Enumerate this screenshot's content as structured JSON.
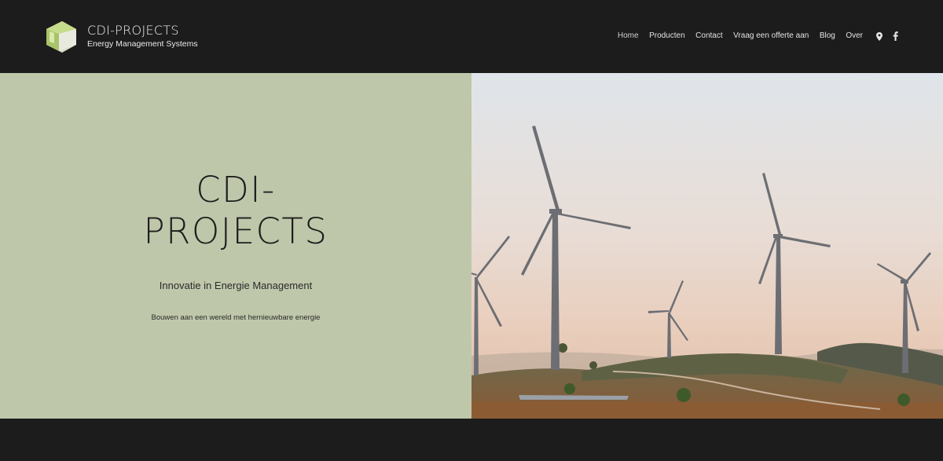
{
  "header": {
    "brand_name": "CDI-PROJECTS",
    "brand_tagline": "Energy Management Systems",
    "logo_icon": "house-logo-icon"
  },
  "nav": {
    "items": [
      {
        "label": "Home",
        "active": true
      },
      {
        "label": "Producten"
      },
      {
        "label": "Contact"
      },
      {
        "label": "Vraag een offerte aan"
      },
      {
        "label": "Blog"
      },
      {
        "label": "Over"
      }
    ],
    "social": [
      "map-pin-icon",
      "facebook-icon"
    ]
  },
  "hero": {
    "title_line1": "CDI-",
    "title_line2": "PROJECTS",
    "subtitle": "Innovatie in Energie Management",
    "tagline": "Bouwen aan een wereld met hernieuwbare energie",
    "image": "wind-turbines-photo"
  },
  "colors": {
    "header_bg": "#1c1c1c",
    "hero_panel": "#bfc7aa",
    "text_dark": "#1e1e1e"
  }
}
